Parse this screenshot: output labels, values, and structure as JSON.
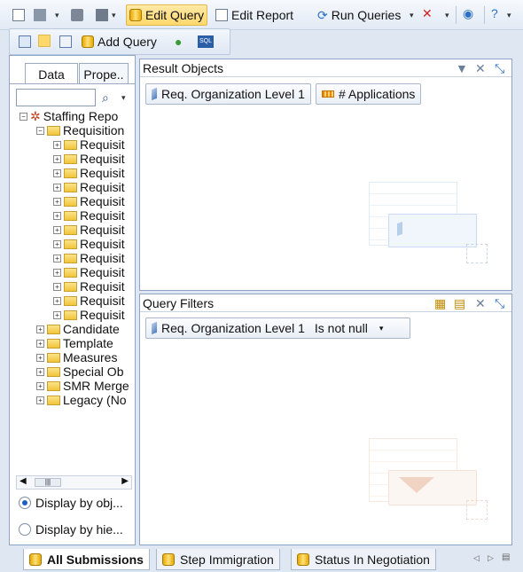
{
  "toolbar": {
    "edit_query": "Edit Query",
    "edit_report": "Edit Report",
    "run_queries": "Run Queries",
    "add_query": "Add Query",
    "sql_label": "SQL"
  },
  "left_panel": {
    "tabs": [
      "Data",
      "Prope.."
    ],
    "tree": {
      "root": "Staffing Repo",
      "open_folder": "Requisition",
      "children": [
        "Requisit",
        "Requisit",
        "Requisit",
        "Requisit",
        "Requisit",
        "Requisit",
        "Requisit",
        "Requisit",
        "Requisit",
        "Requisit",
        "Requisit",
        "Requisit",
        "Requisit"
      ],
      "top_folders": [
        "Candidate",
        "Template",
        "Measures",
        "Special Ob",
        "SMR Merge",
        "Legacy (No"
      ]
    },
    "display_options": [
      "Display by obj...",
      "Display by hie..."
    ]
  },
  "result_objects": {
    "title": "Result Objects",
    "chips": [
      "Req. Organization Level 1",
      "# Applications"
    ]
  },
  "query_filters": {
    "title": "Query Filters",
    "filter_field": "Req. Organization Level 1",
    "filter_op": "Is not null"
  },
  "bottom_tabs": [
    "All Submissions",
    "Step Immigration",
    "Status In Negotiation"
  ],
  "colors": {
    "active_button": "#ffd86b",
    "border": "#8ea4c4",
    "selected_radio": "#1e5ec5"
  }
}
